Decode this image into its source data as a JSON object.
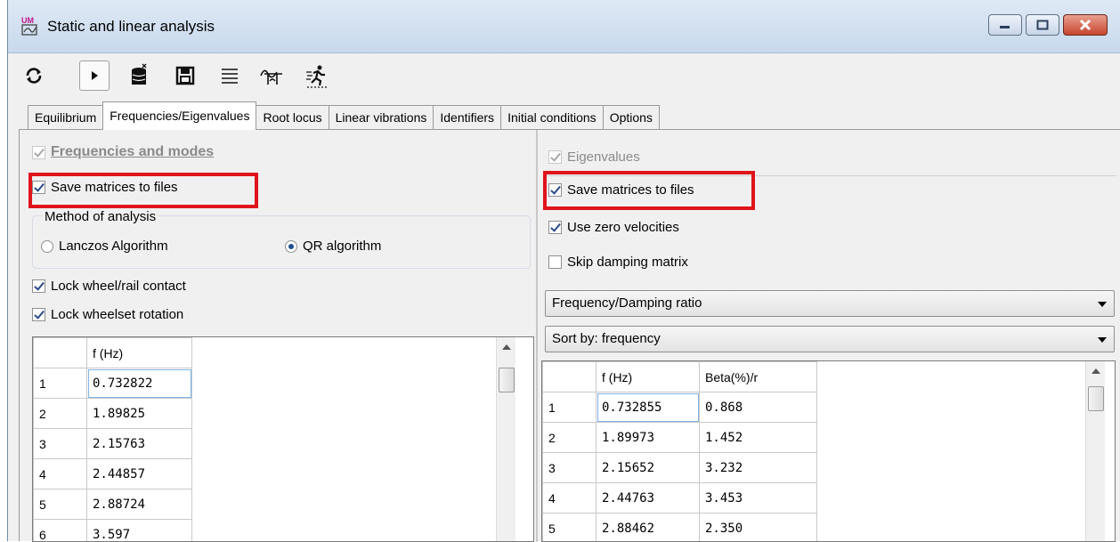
{
  "window": {
    "title": "Static and linear analysis"
  },
  "toolbar": {
    "icons": [
      "refresh-icon",
      "play-icon",
      "database-icon",
      "save-icon",
      "list-icon",
      "wave-icon",
      "run-icon"
    ]
  },
  "tabs": [
    {
      "label": "Equilibrium",
      "active": false
    },
    {
      "label": "Frequencies/Eigenvalues",
      "active": true
    },
    {
      "label": "Root locus",
      "active": false
    },
    {
      "label": "Linear vibrations",
      "active": false
    },
    {
      "label": "Identifiers",
      "active": false
    },
    {
      "label": "Initial conditions",
      "active": false
    },
    {
      "label": "Options",
      "active": false
    }
  ],
  "left": {
    "header_label": "Frequencies and modes",
    "save_matrices_label": "Save matrices to files",
    "method_label": "Method of analysis",
    "radio_lanczos": "Lanczos Algorithm",
    "radio_qr": "QR algorithm",
    "lock_contact_label": "Lock wheel/rail contact",
    "lock_rotation_label": "Lock wheelset rotation",
    "table": {
      "header": "f (Hz)",
      "rows": [
        {
          "i": "1",
          "f": "0.732822"
        },
        {
          "i": "2",
          "f": "1.89825"
        },
        {
          "i": "3",
          "f": "2.15763"
        },
        {
          "i": "4",
          "f": "2.44857"
        },
        {
          "i": "5",
          "f": "2.88724"
        },
        {
          "i": "6",
          "f": "3.597"
        }
      ]
    }
  },
  "right": {
    "eigenvalues_label": "Eigenvalues",
    "save_matrices_label": "Save matrices to files",
    "zero_velocities_label": "Use zero velocities",
    "skip_damping_label": "Skip damping matrix",
    "combo1": "Frequency/Damping ratio",
    "combo2": "Sort by: frequency",
    "table": {
      "header_f": "f (Hz)",
      "header_beta": "Beta(%)/r",
      "rows": [
        {
          "i": "1",
          "f": "0.732855",
          "b": "0.868"
        },
        {
          "i": "2",
          "f": "1.89973",
          "b": "1.452"
        },
        {
          "i": "3",
          "f": "2.15652",
          "b": "3.232"
        },
        {
          "i": "4",
          "f": "2.44763",
          "b": "3.453"
        },
        {
          "i": "5",
          "f": "2.88462",
          "b": "2.350"
        }
      ]
    }
  },
  "colors": {
    "highlight": "#e0141b",
    "accent": "#1d4f91"
  }
}
